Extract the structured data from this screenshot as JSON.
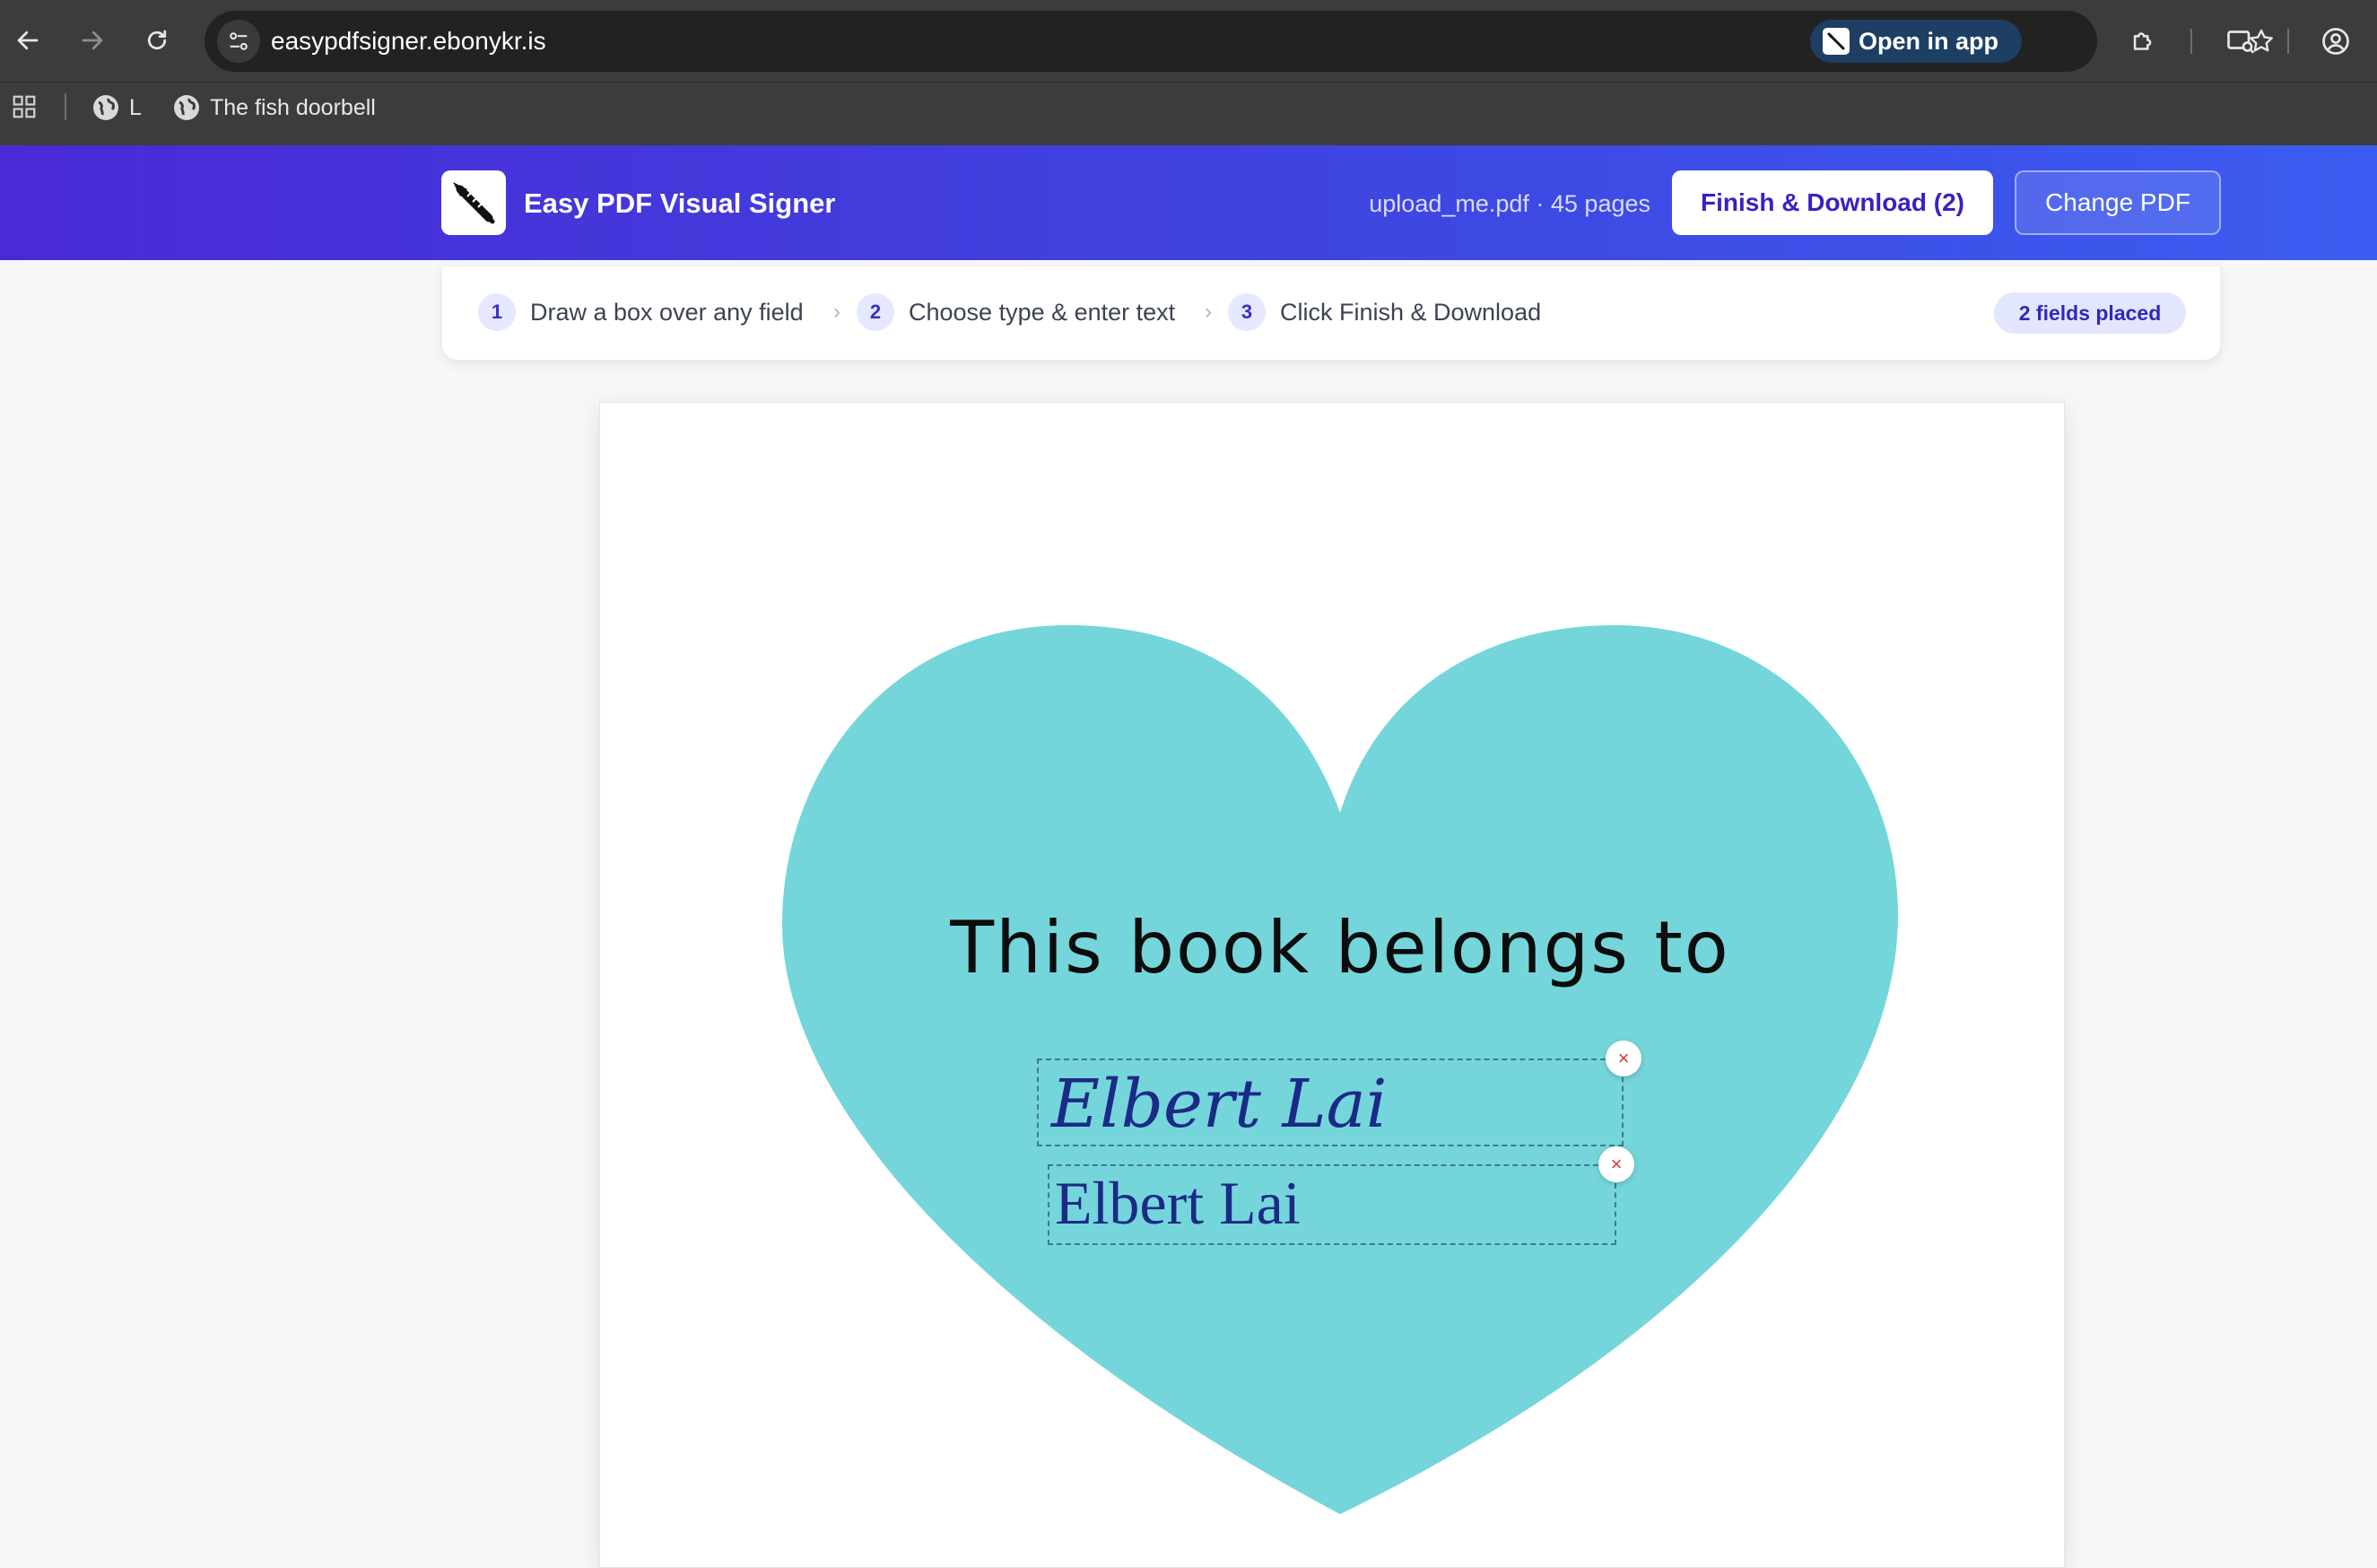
{
  "browser": {
    "url": "easypdfsigner.ebonykr.is",
    "open_in_app": "Open in app",
    "bookmarks": [
      {
        "label": "L"
      },
      {
        "label": "The fish doorbell"
      }
    ]
  },
  "header": {
    "title": "Easy PDF Visual Signer",
    "file_info": "upload_me.pdf · 45 pages",
    "finish_label": "Finish & Download (2)",
    "change_label": "Change PDF"
  },
  "steps": {
    "items": [
      {
        "num": "1",
        "label": "Draw a box over any field"
      },
      {
        "num": "2",
        "label": "Choose type & enter text"
      },
      {
        "num": "3",
        "label": "Click Finish & Download"
      }
    ],
    "badge": "2 fields placed"
  },
  "document": {
    "heading": "This book belongs to",
    "heart_color": "#74d6da",
    "fields": [
      {
        "type": "signature",
        "text": "Elbert Lai",
        "close": "×"
      },
      {
        "type": "text",
        "text": "Elbert Lai",
        "close": "×"
      }
    ]
  },
  "colors": {
    "accent": "#3f44e0",
    "field_text": "#1c2a86"
  }
}
